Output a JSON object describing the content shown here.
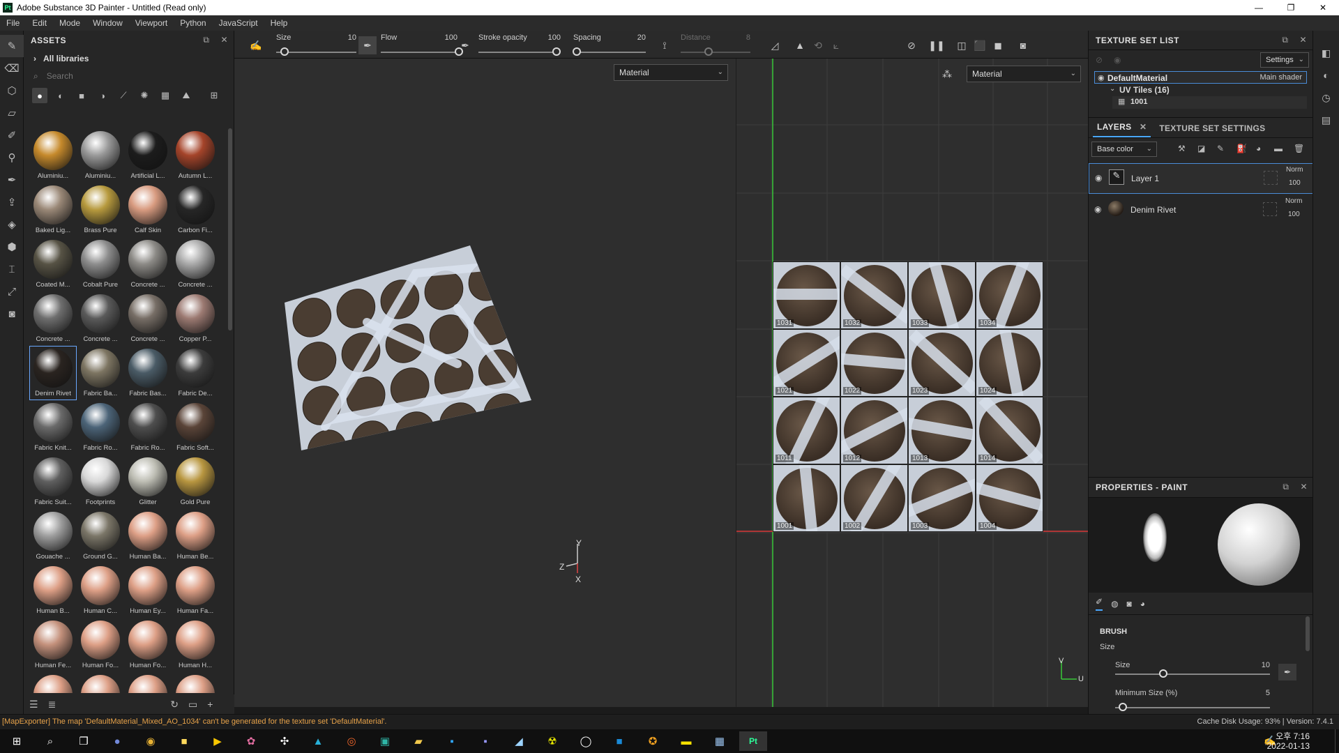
{
  "window": {
    "title": "Adobe Substance 3D Painter - Untitled (Read only)",
    "app_badge": "Pt",
    "minimize": "—",
    "maximize": "❐",
    "close": "✕"
  },
  "menu": [
    "File",
    "Edit",
    "Mode",
    "Window",
    "Viewport",
    "Python",
    "JavaScript",
    "Help"
  ],
  "assets": {
    "title": "ASSETS",
    "library": "All libraries",
    "search_placeholder": "Search",
    "materials": [
      {
        "name": "Aluminiu...",
        "color": "#c68a2c"
      },
      {
        "name": "Aluminiu...",
        "color": "#9a9a9a"
      },
      {
        "name": "Artificial L...",
        "color": "#1c1c1c"
      },
      {
        "name": "Autumn L...",
        "color": "#a5442a"
      },
      {
        "name": "Baked Lig...",
        "color": "#9a8877"
      },
      {
        "name": "Brass Pure",
        "color": "#b79a3e"
      },
      {
        "name": "Calf Skin",
        "color": "#d89b80"
      },
      {
        "name": "Carbon Fi...",
        "color": "#262626"
      },
      {
        "name": "Coated M...",
        "color": "#575345"
      },
      {
        "name": "Cobalt Pure",
        "color": "#8d8d8d"
      },
      {
        "name": "Concrete ...",
        "color": "#8c8a86"
      },
      {
        "name": "Concrete ...",
        "color": "#a9a9a9"
      },
      {
        "name": "Concrete ...",
        "color": "#6e6e6e"
      },
      {
        "name": "Concrete ...",
        "color": "#5a5a5a"
      },
      {
        "name": "Concrete ...",
        "color": "#776e66"
      },
      {
        "name": "Copper P...",
        "color": "#9c7a72"
      },
      {
        "name": "Denim Rivet",
        "color": "#2a2420"
      },
      {
        "name": "Fabric Ba...",
        "color": "#7d7562"
      },
      {
        "name": "Fabric Bas...",
        "color": "#4a5b66"
      },
      {
        "name": "Fabric De...",
        "color": "#3c3c3c"
      },
      {
        "name": "Fabric Knit...",
        "color": "#6a6a6a"
      },
      {
        "name": "Fabric Ro...",
        "color": "#4c6478"
      },
      {
        "name": "Fabric Ro...",
        "color": "#4e4e4e"
      },
      {
        "name": "Fabric Soft...",
        "color": "#5a4438"
      },
      {
        "name": "Fabric Suit...",
        "color": "#5f5f5f"
      },
      {
        "name": "Footprints",
        "color": "#d8d8d8"
      },
      {
        "name": "Glitter",
        "color": "#bdbdb3"
      },
      {
        "name": "Gold Pure",
        "color": "#b89640"
      },
      {
        "name": "Gouache ...",
        "color": "#9e9e9e"
      },
      {
        "name": "Ground G...",
        "color": "#7b7668"
      },
      {
        "name": "Human Ba...",
        "color": "#dd9f86"
      },
      {
        "name": "Human Be...",
        "color": "#dd9f86"
      },
      {
        "name": "Human B...",
        "color": "#dd9f86"
      },
      {
        "name": "Human C...",
        "color": "#dd9f86"
      },
      {
        "name": "Human Ey...",
        "color": "#dd9f86"
      },
      {
        "name": "Human Fa...",
        "color": "#dd9f86"
      },
      {
        "name": "Human Fe...",
        "color": "#c4917c"
      },
      {
        "name": "Human Fo...",
        "color": "#dd9f86"
      },
      {
        "name": "Human Fo...",
        "color": "#dd9f86"
      },
      {
        "name": "Human H...",
        "color": "#dd9f86"
      },
      {
        "name": "",
        "color": "#dd9f86"
      },
      {
        "name": "",
        "color": "#dd9f86"
      },
      {
        "name": "",
        "color": "#dd9f86"
      },
      {
        "name": "",
        "color": "#dd9f86"
      }
    ],
    "selected_index": 16
  },
  "toolbar": {
    "size_label": "Size",
    "size_value": "10",
    "size_fraction": 0.1,
    "flow_label": "Flow",
    "flow_value": "100",
    "flow_fraction": 1.0,
    "stroke_opacity_label": "Stroke opacity",
    "stroke_opacity_value": "100",
    "stroke_opacity_fraction": 1.0,
    "spacing_label": "Spacing",
    "spacing_value": "20",
    "spacing_fraction": 0.05,
    "distance_label": "Distance",
    "distance_value": "8"
  },
  "viewport3d": {
    "mode": "Material",
    "axis_y": "Y",
    "axis_z": "Z",
    "axis_x": "X"
  },
  "viewport2d": {
    "mode": "Material",
    "axis_v": "V",
    "axis_u": "U",
    "tiles": [
      [
        "1031",
        "1032",
        "1033",
        "1034"
      ],
      [
        "1021",
        "1022",
        "1023",
        "1024"
      ],
      [
        "1011",
        "1012",
        "1013",
        "1014"
      ],
      [
        "1001",
        "1002",
        "1003",
        "1004"
      ]
    ]
  },
  "texture_set_list": {
    "title": "TEXTURE SET LIST",
    "settings": "Settings",
    "material": "DefaultMaterial",
    "shader": "Main shader",
    "uv_tiles": "UV Tiles (16)",
    "tile": "1001"
  },
  "layers": {
    "tab_layers": "LAYERS",
    "tab_settings": "TEXTURE SET SETTINGS",
    "channel": "Base color",
    "items": [
      {
        "name": "Layer 1",
        "blend": "Norm",
        "opacity": "100"
      },
      {
        "name": "Denim Rivet",
        "blend": "Norm",
        "opacity": "100"
      }
    ]
  },
  "properties": {
    "title": "PROPERTIES - PAINT",
    "section": "BRUSH",
    "size_group": "Size",
    "size_label": "Size",
    "size_value": "10",
    "size_fraction": 0.31,
    "min_size_label": "Minimum Size (%)",
    "min_size_value": "5",
    "min_size_fraction": 0.05
  },
  "status": {
    "message": "[MapExporter] The map 'DefaultMaterial_Mixed_AO_1034' can't be generated for the texture set 'DefaultMaterial'.",
    "cache": "Cache Disk Usage:   93% | Version: 7.4.1"
  },
  "taskbar": {
    "time": "오후 7:16",
    "date": "2022-01-13"
  }
}
